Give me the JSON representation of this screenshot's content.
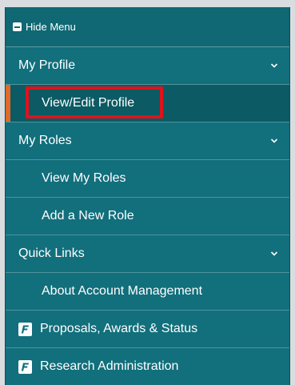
{
  "menu": {
    "hide_label": "Hide Menu"
  },
  "sections": [
    {
      "label": "My Profile",
      "items": [
        {
          "label": "View/Edit Profile",
          "active": true
        }
      ]
    },
    {
      "label": "My Roles",
      "items": [
        {
          "label": "View My Roles"
        },
        {
          "label": "Add a New Role"
        }
      ]
    },
    {
      "label": "Quick Links",
      "items": [
        {
          "label": "About Account Management"
        }
      ]
    }
  ],
  "external_links": [
    {
      "label": "Proposals, Awards & Status",
      "icon": "f-badge-icon"
    },
    {
      "label": "Research Administration",
      "icon": "f-badge-icon"
    }
  ],
  "colors": {
    "menu_bg": "#126f7c",
    "active_bg": "#0b5a64",
    "active_indicator": "#e06a2a",
    "highlight_box": "#e0121b"
  }
}
